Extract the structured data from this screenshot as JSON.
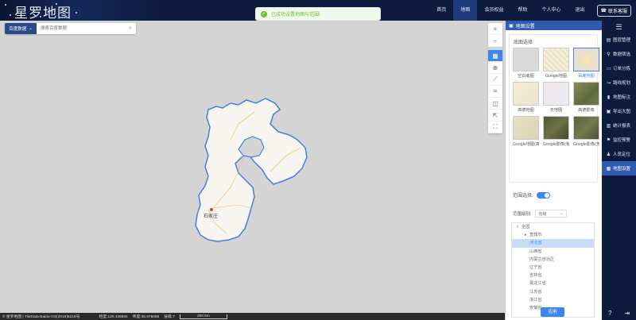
{
  "app": {
    "logo": "星罗地图"
  },
  "nav": [
    {
      "label": "首页"
    },
    {
      "label": "地图"
    },
    {
      "label": "会员权益"
    },
    {
      "label": "帮助"
    },
    {
      "label": "个人中心"
    },
    {
      "label": "退出"
    }
  ],
  "nav_active_index": 1,
  "service": {
    "label": "联系客服"
  },
  "toast": {
    "message": "已成功设置地图与范围!",
    "icon": "check-circle-icon"
  },
  "search": {
    "source": "百度数据",
    "placeholder": "搜索百度数据"
  },
  "map_tools": [
    "zoom-in-icon",
    "zoom-out-icon",
    "layers-icon",
    "locate-icon",
    "ruler-icon",
    "crop-icon",
    "area-select-icon",
    "export-icon",
    "fullscreen-icon"
  ],
  "status": {
    "copyright": "© 星罗地图 | TileData-Baidu-GS(2019)5218号",
    "longitude": "经度:120.436684",
    "latitude": "纬度:35.976066",
    "zoom": "层级:7",
    "scale": "200 km"
  },
  "map_labels": {
    "capital": "石家庄"
  },
  "panel": {
    "title": "地图设置",
    "basemap_title": "底图选择",
    "basemaps": [
      {
        "label": "空白底图",
        "style": "t-blank"
      },
      {
        "label": "Google地图",
        "style": "t-google"
      },
      {
        "label": "百度地图",
        "style": "t-baidu"
      },
      {
        "label": "高德地图",
        "style": "t-gaode"
      },
      {
        "label": "天地图",
        "style": "t-tian"
      },
      {
        "label": "高德影像",
        "style": "t-sat"
      },
      {
        "label": "Google地图(高",
        "style": "t-gmix"
      },
      {
        "label": "Google影像(有",
        "style": "t-gsat"
      },
      {
        "label": "Google影像(无",
        "style": "t-gsat2"
      }
    ],
    "basemap_selected_index": 2,
    "range_label": "范围选择:",
    "range_enabled": true,
    "level_label": "范围级别:",
    "level_value": "省级",
    "tree": [
      {
        "label": "全国",
        "level": 0,
        "prefix": "▿"
      },
      {
        "label": "直辖市",
        "level": 1,
        "prefix": "▸"
      },
      {
        "label": "河北省",
        "level": 1,
        "prefix": ""
      },
      {
        "label": "山西省",
        "level": 1,
        "prefix": ""
      },
      {
        "label": "内蒙古自治区",
        "level": 1,
        "prefix": ""
      },
      {
        "label": "辽宁省",
        "level": 1,
        "prefix": ""
      },
      {
        "label": "吉林省",
        "level": 1,
        "prefix": ""
      },
      {
        "label": "黑龙江省",
        "level": 1,
        "prefix": ""
      },
      {
        "label": "江苏省",
        "level": 1,
        "prefix": ""
      },
      {
        "label": "浙江省",
        "level": 1,
        "prefix": ""
      },
      {
        "label": "安徽省",
        "level": 1,
        "prefix": ""
      }
    ],
    "tree_selected_index": 2,
    "apply_label": "应用"
  },
  "right_nav": [
    {
      "label": "图层管理",
      "icon": "layers-icon"
    },
    {
      "label": "数据筛选",
      "icon": "filter-icon"
    },
    {
      "label": "订单分拣",
      "icon": "order-icon"
    },
    {
      "label": "路线规划",
      "icon": "route-icon"
    },
    {
      "label": "地图标注",
      "icon": "marker-icon"
    },
    {
      "label": "导出大图",
      "icon": "export-image-icon"
    },
    {
      "label": "统计报表",
      "icon": "report-icon"
    },
    {
      "label": "监控预警",
      "icon": "alert-icon"
    },
    {
      "label": "人员定位",
      "icon": "person-icon"
    },
    {
      "label": "地图设置",
      "icon": "map-settings-icon"
    }
  ],
  "right_nav_active_index": 9,
  "colors": {
    "accent": "#3d86f1",
    "header": "#0d1b3e",
    "success": "#67c23a"
  }
}
